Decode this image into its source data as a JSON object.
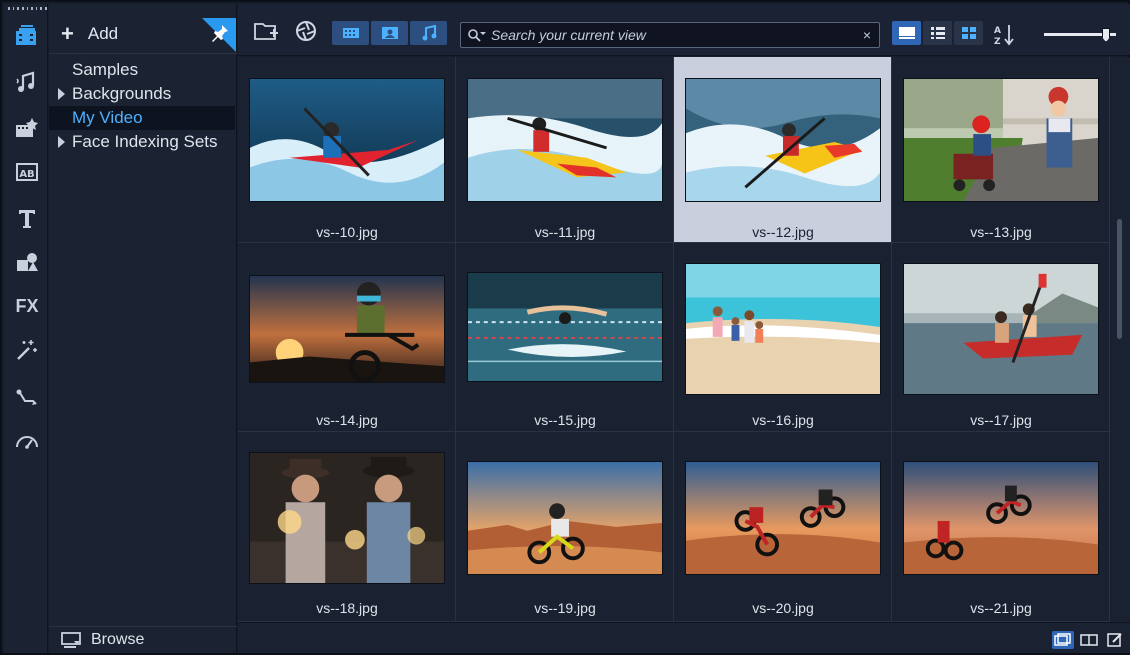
{
  "tree": {
    "add_label": "Add",
    "browse_label": "Browse",
    "items": [
      {
        "label": "Samples",
        "expandable": false,
        "selected": false
      },
      {
        "label": "Backgrounds",
        "expandable": true,
        "selected": false
      },
      {
        "label": "My Video",
        "expandable": false,
        "selected": true
      },
      {
        "label": "Face Indexing Sets",
        "expandable": true,
        "selected": false
      }
    ]
  },
  "rail": {
    "tools": [
      "media-library-icon",
      "sound-icon",
      "instant-project-icon",
      "title-ab-icon",
      "text-icon",
      "graphics-icon",
      "fx-icon",
      "filter-magic-icon",
      "path-icon",
      "speed-icon"
    ],
    "fx_label": "FX"
  },
  "toolbar": {
    "filters": [
      "video-filter-icon",
      "photo-filter-icon",
      "audio-filter-icon"
    ],
    "search_placeholder": "Search your current view",
    "views": [
      "thumbnail-view-icon",
      "list-view-icon",
      "grid-view-icon"
    ]
  },
  "library": {
    "items": [
      {
        "name": "vs--10.jpg",
        "selected": false,
        "scene": "kayak-red"
      },
      {
        "name": "vs--11.jpg",
        "selected": false,
        "scene": "kayak-yellow"
      },
      {
        "name": "vs--12.jpg",
        "selected": true,
        "scene": "kayak-rapids"
      },
      {
        "name": "vs--13.jpg",
        "selected": false,
        "scene": "kids-cart"
      },
      {
        "name": "vs--14.jpg",
        "selected": false,
        "scene": "biker-sunset"
      },
      {
        "name": "vs--15.jpg",
        "selected": false,
        "scene": "swimmer"
      },
      {
        "name": "vs--16.jpg",
        "selected": false,
        "scene": "beach-family"
      },
      {
        "name": "vs--17.jpg",
        "selected": false,
        "scene": "canoe-couple"
      },
      {
        "name": "vs--18.jpg",
        "selected": false,
        "scene": "sparklers"
      },
      {
        "name": "vs--19.jpg",
        "selected": false,
        "scene": "dirtbike-desert"
      },
      {
        "name": "vs--20.jpg",
        "selected": false,
        "scene": "dirtbike-jump-pair"
      },
      {
        "name": "vs--21.jpg",
        "selected": false,
        "scene": "dirtbike-jump-dusk"
      }
    ]
  },
  "colors": {
    "accent": "#4cb1ff",
    "selected_cell": "#c9cfdd",
    "filter_button": "#2d4f80",
    "active_view": "#2f66b5"
  }
}
